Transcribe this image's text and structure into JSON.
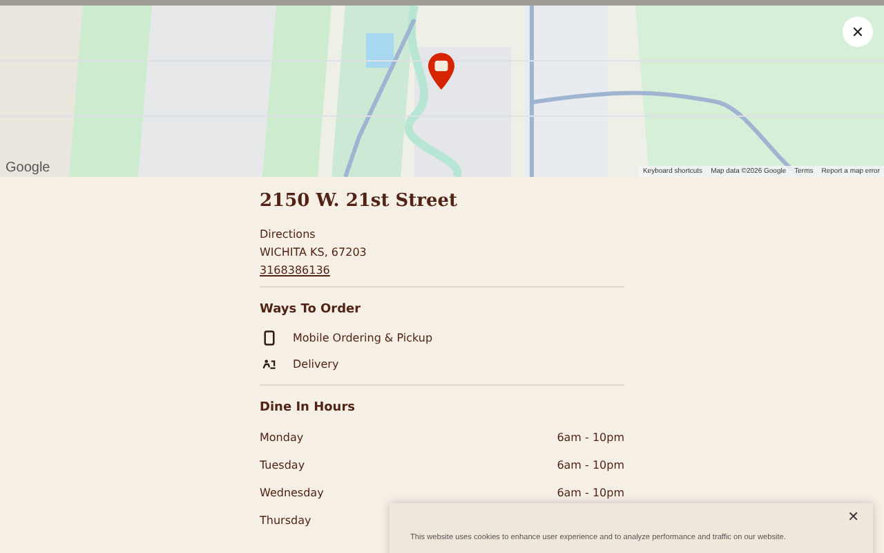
{
  "map": {
    "attribution_logo": "Google",
    "footer_links": [
      "Keyboard shortcuts",
      "Map data ©2026 Google",
      "Terms",
      "Report a map error"
    ],
    "close_label": "✕"
  },
  "store": {
    "title": "2150 W. 21st Street",
    "directions": "Directions",
    "address": "WICHITA KS, 67203",
    "phone": "3168386136"
  },
  "ways_to_order": {
    "heading": "Ways To Order",
    "items": [
      {
        "kind": "mobile",
        "label": "Mobile Ordering & Pickup"
      },
      {
        "kind": "delivery",
        "label": "Delivery"
      }
    ]
  },
  "dine_in_hours": {
    "heading": "Dine In Hours",
    "rows": [
      {
        "day": "Monday",
        "hours": "6am - 10pm"
      },
      {
        "day": "Tuesday",
        "hours": "6am - 10pm"
      },
      {
        "day": "Wednesday",
        "hours": "6am - 10pm"
      },
      {
        "day": "Thursday"
      }
    ]
  },
  "cookie_banner": {
    "close_label": "✕",
    "lines": [
      "This website uses cookies to enhance user experience and to analyze performance and traffic on our website."
    ]
  }
}
